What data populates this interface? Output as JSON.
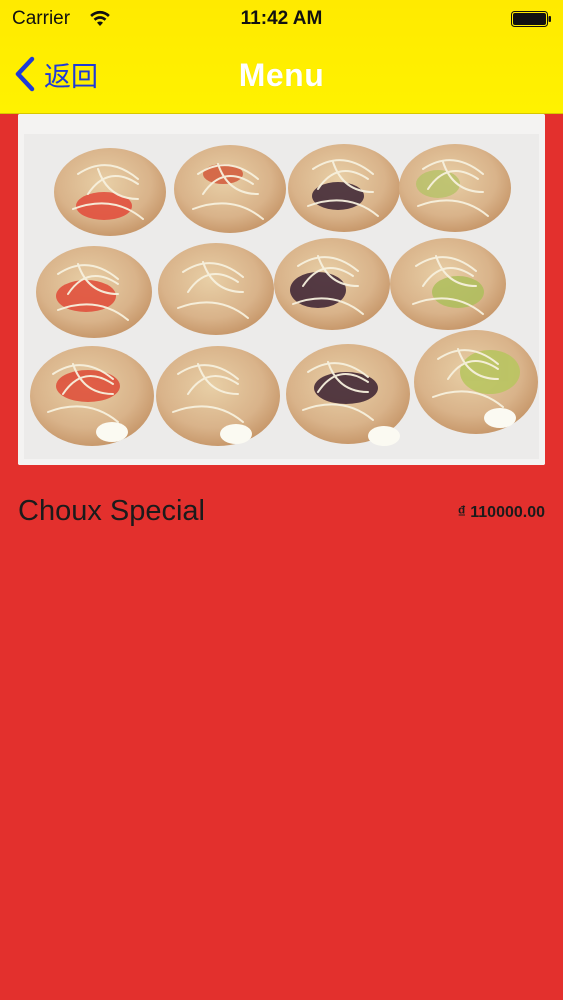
{
  "status_bar": {
    "carrier": "Carrier",
    "time": "11:42 AM",
    "wifi_icon": "wifi-icon",
    "battery_icon": "battery-icon"
  },
  "nav": {
    "back_label": "返回",
    "back_icon": "chevron-left-icon",
    "title": "Menu"
  },
  "product": {
    "name": "Choux Special",
    "price": "₫ 110000.00"
  },
  "colors": {
    "nav_background": "#ffea00",
    "page_background": "#e3302d",
    "back_tint": "#1e3ad8",
    "title_text": "#ffffff"
  }
}
